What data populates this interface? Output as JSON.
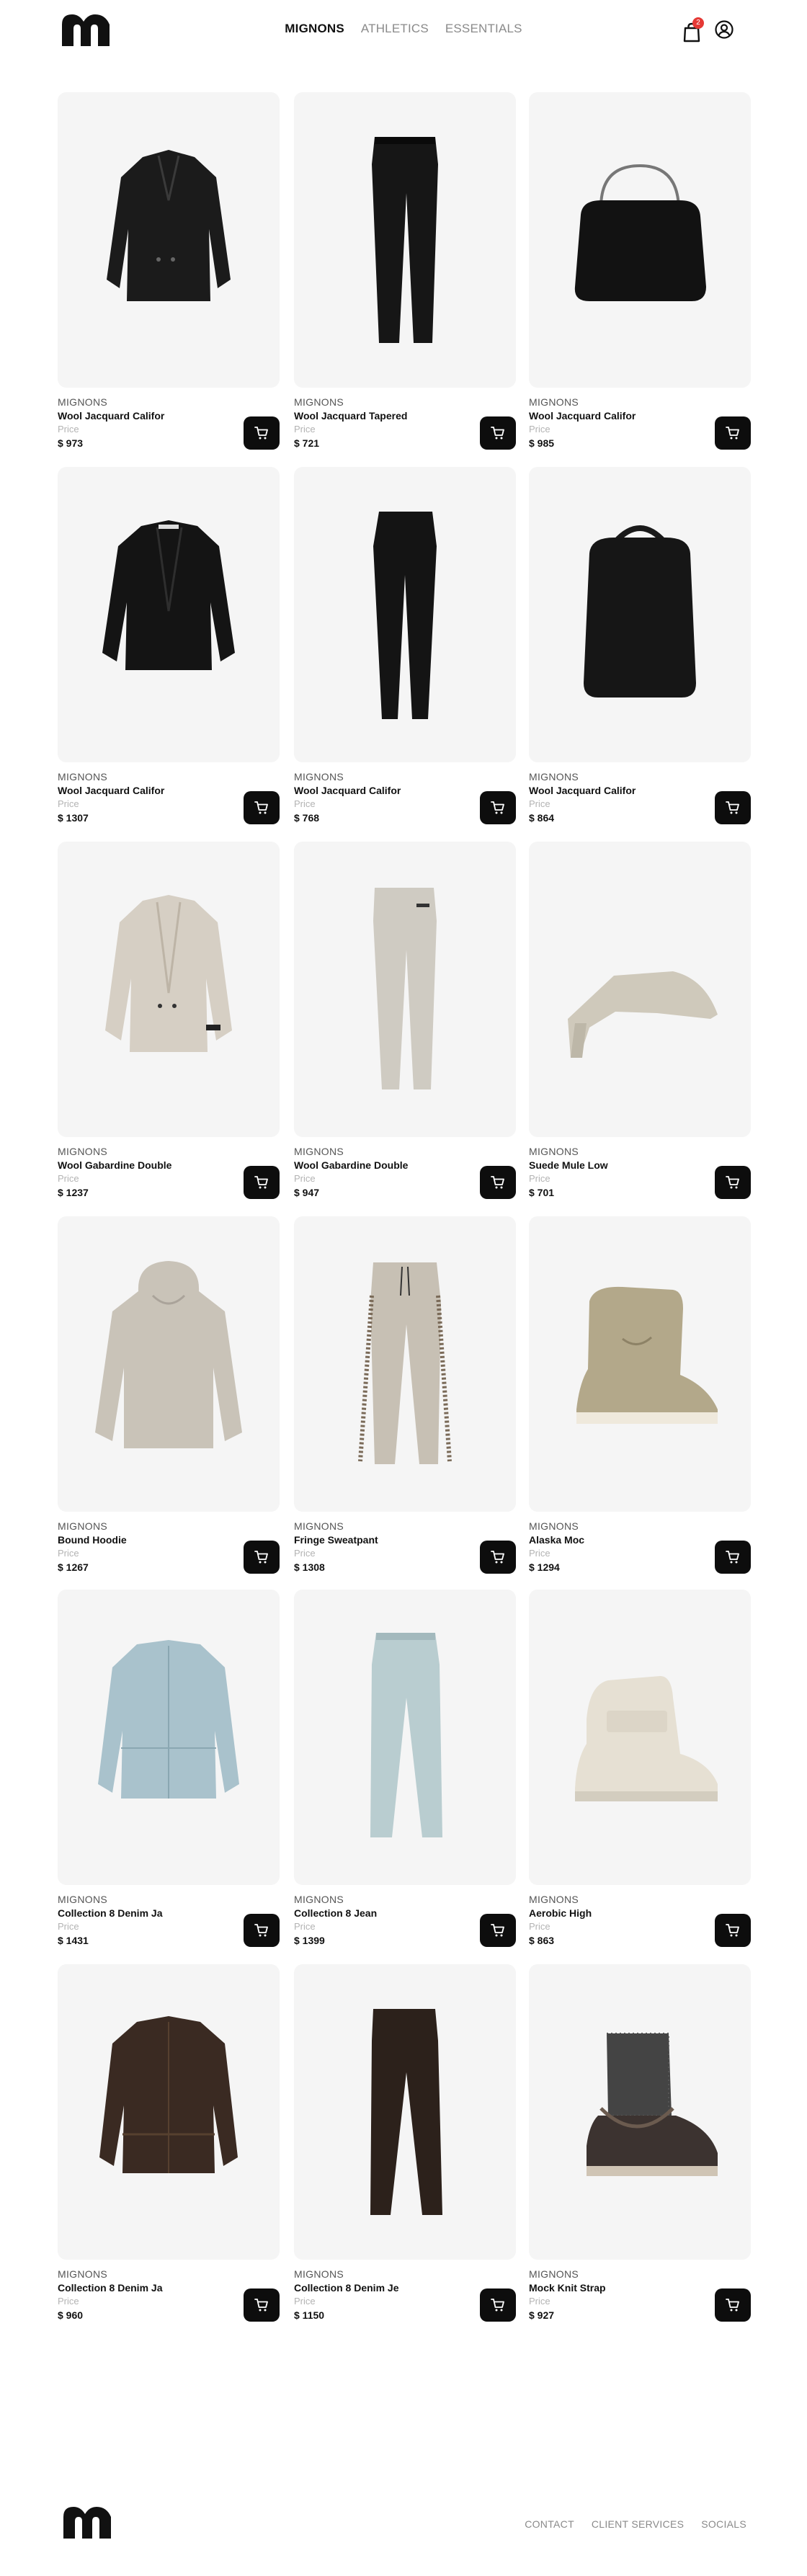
{
  "header": {
    "logo_alt": "M",
    "nav": [
      {
        "label": "MIGNONS",
        "active": true
      },
      {
        "label": "ATHLETICS",
        "active": false
      },
      {
        "label": "ESSENTIALS",
        "active": false
      }
    ],
    "cart_count": "2",
    "colors": {
      "accent": "#111111",
      "badge": "#e53935"
    }
  },
  "products": [
    {
      "brand": "MIGNONS",
      "name": "Wool Jacquard Califor",
      "price_label": "Price",
      "price": "$ 973",
      "image": "black-blazer"
    },
    {
      "brand": "MIGNONS",
      "name": "Wool Jacquard Tapered",
      "price_label": "Price",
      "price": "$ 721",
      "image": "black-trousers"
    },
    {
      "brand": "MIGNONS",
      "name": "Wool Jacquard Califor",
      "price_label": "Price",
      "price": "$ 985",
      "image": "black-handbag"
    },
    {
      "brand": "MIGNONS",
      "name": "Wool Jacquard Califor",
      "price_label": "Price",
      "price": "$ 1307",
      "image": "black-jacket"
    },
    {
      "brand": "MIGNONS",
      "name": "Wool Jacquard Califor",
      "price_label": "Price",
      "price": "$ 768",
      "image": "black-pants"
    },
    {
      "brand": "MIGNONS",
      "name": "Wool Jacquard Califor",
      "price_label": "Price",
      "price": "$ 864",
      "image": "black-backpack"
    },
    {
      "brand": "MIGNONS",
      "name": "Wool Gabardine Double",
      "price_label": "Price",
      "price": "$ 1237",
      "image": "beige-blazer"
    },
    {
      "brand": "MIGNONS",
      "name": "Wool Gabardine Double",
      "price_label": "Price",
      "price": "$ 947",
      "image": "beige-trousers"
    },
    {
      "brand": "MIGNONS",
      "name": "Suede Mule Low",
      "price_label": "Price",
      "price": "$ 701",
      "image": "beige-mule"
    },
    {
      "brand": "MIGNONS",
      "name": "Bound Hoodie",
      "price_label": "Price",
      "price": "$ 1267",
      "image": "beige-hoodie"
    },
    {
      "brand": "MIGNONS",
      "name": "Fringe Sweatpant",
      "price_label": "Price",
      "price": "$ 1308",
      "image": "fringe-sweatpant"
    },
    {
      "brand": "MIGNONS",
      "name": "Alaska Moc",
      "price_label": "Price",
      "price": "$ 1294",
      "image": "alaska-moc"
    },
    {
      "brand": "MIGNONS",
      "name": "Collection 8 Denim Ja",
      "price_label": "Price",
      "price": "$ 1431",
      "image": "denim-jacket"
    },
    {
      "brand": "MIGNONS",
      "name": "Collection 8 Jean",
      "price_label": "Price",
      "price": "$ 1399",
      "image": "light-jeans"
    },
    {
      "brand": "MIGNONS",
      "name": "Aerobic High",
      "price_label": "Price",
      "price": "$ 863",
      "image": "aerobic-high"
    },
    {
      "brand": "MIGNONS",
      "name": "Collection 8 Denim Ja",
      "price_label": "Price",
      "price": "$ 960",
      "image": "brown-jacket"
    },
    {
      "brand": "MIGNONS",
      "name": "Collection 8 Denim Je",
      "price_label": "Price",
      "price": "$ 1150",
      "image": "brown-jeans"
    },
    {
      "brand": "MIGNONS",
      "name": "Mock Knit Strap",
      "price_label": "Price",
      "price": "$ 927",
      "image": "knit-boot"
    }
  ],
  "footer": {
    "links": [
      "CONTACT",
      "CLIENT SERVICES",
      "SOCIALS"
    ]
  }
}
